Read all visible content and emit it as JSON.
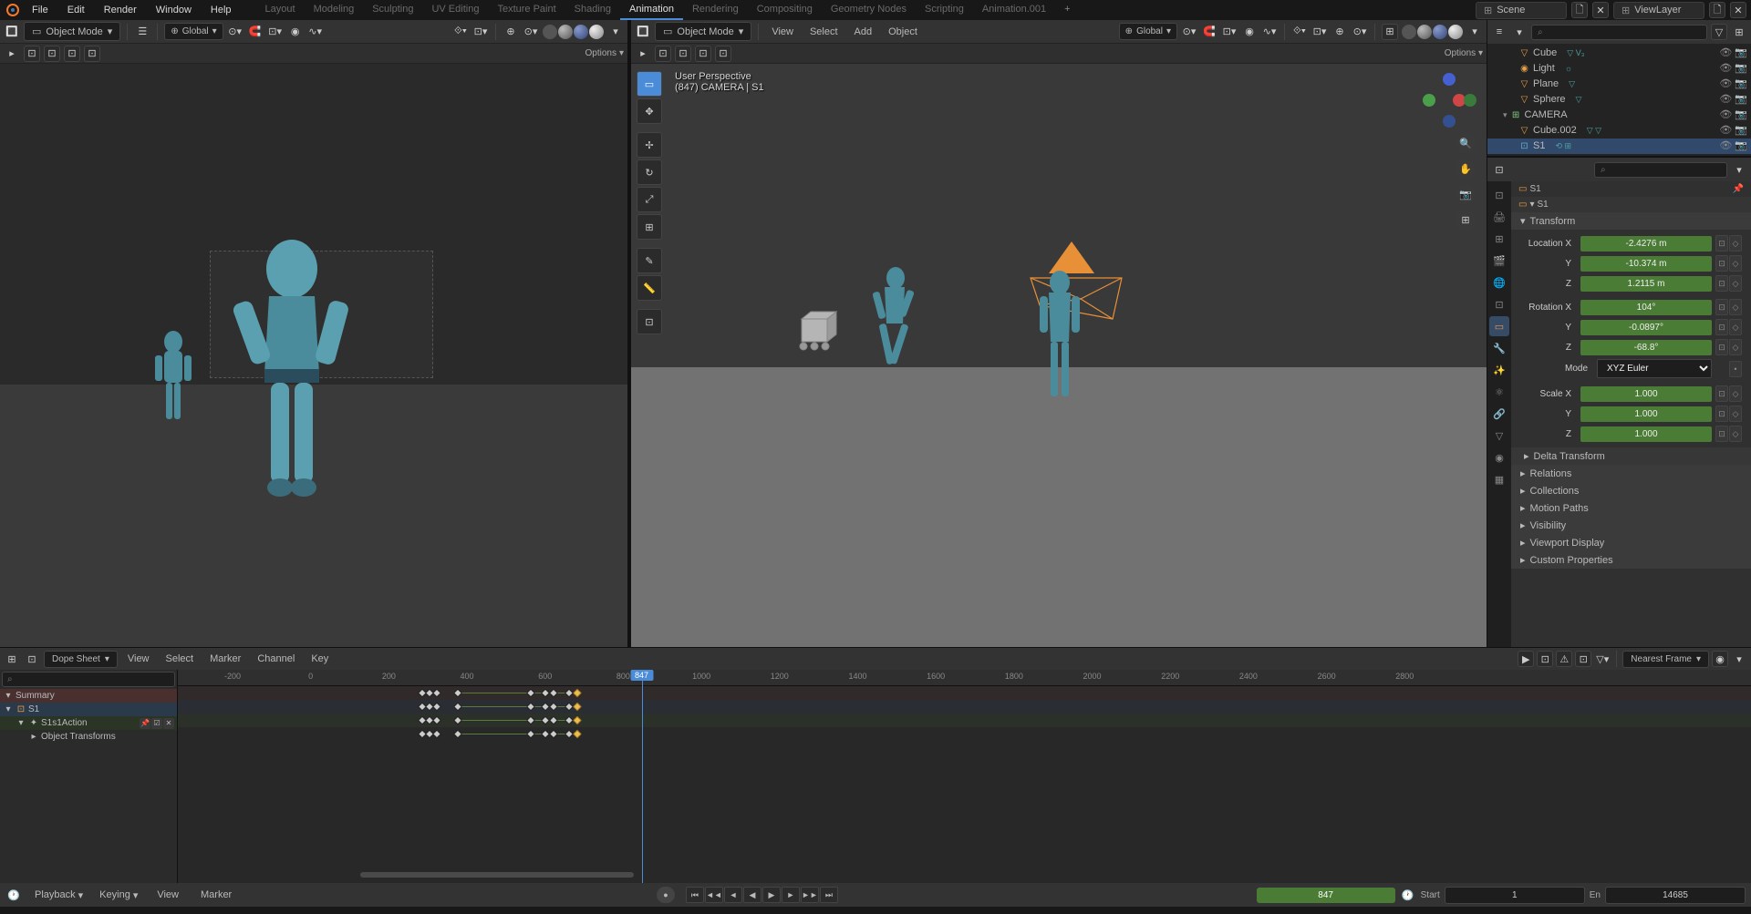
{
  "topMenu": {
    "file": "File",
    "edit": "Edit",
    "render": "Render",
    "window": "Window",
    "help": "Help"
  },
  "workspaces": [
    "Layout",
    "Modeling",
    "Sculpting",
    "UV Editing",
    "Texture Paint",
    "Shading",
    "Animation",
    "Rendering",
    "Compositing",
    "Geometry Nodes",
    "Scripting",
    "Animation.001"
  ],
  "activeWorkspace": "Animation",
  "scene": "Scene",
  "viewLayer": "ViewLayer",
  "viewportHeader": {
    "mode": "Object Mode",
    "view": "View",
    "select": "Select",
    "add": "Add",
    "object": "Object",
    "global": "Global",
    "options": "Options"
  },
  "perspective": {
    "line1": "User Perspective",
    "line2": "(847) CAMERA | S1"
  },
  "outliner": [
    {
      "name": "Cube",
      "type": "mesh",
      "indent": 24,
      "links": "▽   V₃"
    },
    {
      "name": "Light",
      "type": "light",
      "indent": 24,
      "links": "☼"
    },
    {
      "name": "Plane",
      "type": "mesh",
      "indent": 24,
      "links": "▽"
    },
    {
      "name": "Sphere",
      "type": "mesh",
      "indent": 24,
      "links": "▽"
    },
    {
      "name": "CAMERA",
      "type": "coll",
      "indent": 10,
      "links": "",
      "coll": true
    },
    {
      "name": "Cube.002",
      "type": "mesh",
      "indent": 24,
      "links": "▽  ▽"
    },
    {
      "name": "S1",
      "type": "arm",
      "indent": 24,
      "links": "⟲ ⊞",
      "sel": true
    }
  ],
  "propsBreadcrumb": {
    "item": "S1"
  },
  "transform": {
    "header": "Transform",
    "locX": {
      "label": "Location X",
      "val": "-2.4276 m"
    },
    "locY": {
      "label": "Y",
      "val": "-10.374 m"
    },
    "locZ": {
      "label": "Z",
      "val": "1.2115 m"
    },
    "rotX": {
      "label": "Rotation X",
      "val": "104°"
    },
    "rotY": {
      "label": "Y",
      "val": "-0.0897°"
    },
    "rotZ": {
      "label": "Z",
      "val": "-68.8°"
    },
    "mode": {
      "label": "Mode",
      "val": "XYZ Euler"
    },
    "sclX": {
      "label": "Scale X",
      "val": "1.000"
    },
    "sclY": {
      "label": "Y",
      "val": "1.000"
    },
    "sclZ": {
      "label": "Z",
      "val": "1.000"
    }
  },
  "sections": {
    "delta": "Delta Transform",
    "rel": "Relations",
    "coll": "Collections",
    "mp": "Motion Paths",
    "vis": "Visibility",
    "vd": "Viewport Display",
    "cp": "Custom Properties"
  },
  "dopesheet": {
    "mode": "Dope Sheet",
    "view": "View",
    "select": "Select",
    "marker": "Marker",
    "channel": "Channel",
    "key": "Key",
    "filter": "Nearest Frame"
  },
  "channels": {
    "summary": "Summary",
    "s1": "S1",
    "action": "S1s1Action",
    "xforms": "Object Transforms"
  },
  "ruler": [
    -200,
    0,
    200,
    400,
    600,
    800,
    1000,
    1200,
    1400,
    1600,
    1800,
    2000,
    2200,
    2400,
    2600,
    2800
  ],
  "rulerStart": -340,
  "rulerStep": 200,
  "currentFrame": 847,
  "keyframes": {
    "groups": [
      [
        286,
        305,
        322
      ],
      [
        376
      ],
      [
        564,
        600,
        621,
        661,
        683
      ]
    ],
    "lines": [
      [
        286,
        322
      ],
      [
        376,
        683
      ]
    ]
  },
  "footer": {
    "playback": "Playback",
    "keying": "Keying",
    "view": "View",
    "marker": "Marker",
    "start": "Start",
    "startV": "1",
    "end": "En",
    "endV": "14685",
    "frame": "847"
  },
  "searchPlaceholder": "",
  "searchIcon": "⌕"
}
